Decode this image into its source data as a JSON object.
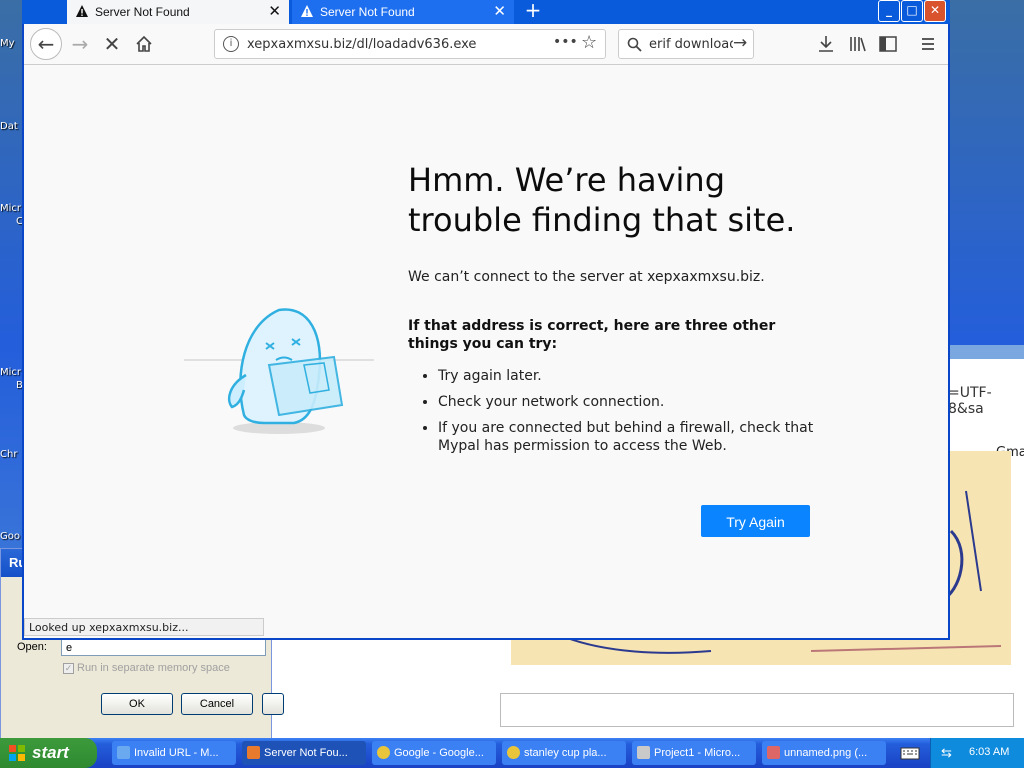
{
  "desktop": {
    "icon_labels": [
      "My",
      "Dat",
      "Micr",
      "C",
      "Micr",
      "B",
      "Chr",
      "Goo"
    ]
  },
  "background_window": {
    "url_fragment": "=UTF-8&sa",
    "gmail_text": "Gma"
  },
  "run_dialog": {
    "title": "Ru",
    "open_label": "Open:",
    "open_value": "e",
    "checkbox_label": "Run in separate memory space",
    "ok_label": "OK",
    "cancel_label": "Cancel"
  },
  "browser": {
    "tabs": [
      {
        "title": "Server Not Found",
        "active": true
      },
      {
        "title": "Server Not Found",
        "active": false
      }
    ],
    "new_tab_symbol": "+",
    "url": "xepxaxmxsu.biz/dl/loadadv636.exe",
    "search_text": "erif download",
    "error": {
      "title": "Hmm. We’re having trouble finding that site.",
      "description": "We can’t connect to the server at xepxaxmxsu.biz.",
      "suggestions_heading": "If that address is correct, here are three other things you can try:",
      "suggestions": [
        "Try again later.",
        "Check your network connection.",
        "If you are connected but behind a firewall, check that Mypal has permission to access the Web."
      ],
      "try_again_label": "Try Again"
    },
    "status": "Looked up xepxaxmxsu.biz..."
  },
  "taskbar": {
    "start_label": "start",
    "items": [
      {
        "label": "Invalid URL - M...",
        "icon": "ie-icon"
      },
      {
        "label": "Server Not Fou...",
        "icon": "firefox-icon",
        "active": true
      },
      {
        "label": "Google - Google...",
        "icon": "chrome-icon"
      },
      {
        "label": "stanley cup pla...",
        "icon": "chrome-icon"
      },
      {
        "label": "Project1 - Micro...",
        "icon": "vb-icon"
      },
      {
        "label": "unnamed.png (...",
        "icon": "paint-icon"
      }
    ],
    "clock": "6:03 AM"
  },
  "colors": {
    "accent": "#0a84ff",
    "window_frame": "#0a47c8",
    "taskbar": "#245edb",
    "start_green": "#3c9a3c"
  }
}
